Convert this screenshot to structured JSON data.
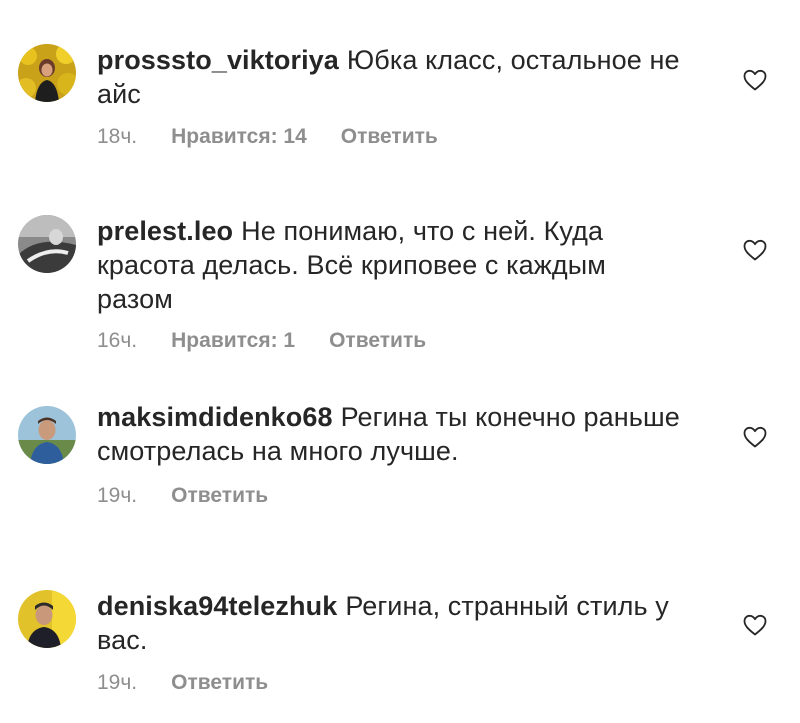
{
  "comments": [
    {
      "username": "prosssto_viktoriya",
      "text": "Юбка класс, остальное не айс",
      "time": "18ч.",
      "likes": "Нравится: 14",
      "reply": "Ответить",
      "avatar_icon": "avatar-photo-yellow-flowers",
      "like_icon": "heart-outline-icon"
    },
    {
      "username": "prelest.leo",
      "text": "Не понимаю, что с ней. Куда красота делась. Всё криповее с каждым разом",
      "time": "16ч.",
      "likes": "Нравится: 1",
      "reply": "Ответить",
      "avatar_icon": "avatar-photo-grayscale",
      "like_icon": "heart-outline-icon"
    },
    {
      "username": "maksimdidenko68",
      "text": "Регина ты конечно раньше смотрелась на много лучше.",
      "time": "19ч.",
      "reply": "Ответить",
      "avatar_icon": "avatar-photo-man-outdoors",
      "like_icon": "heart-outline-icon"
    },
    {
      "username": "deniska94telezhuk",
      "text": "Регина, странный стиль у вас.",
      "time": "19ч.",
      "reply": "Ответить",
      "avatar_icon": "avatar-photo-man-yellow-bg",
      "like_icon": "heart-outline-icon"
    }
  ],
  "colors": {
    "text": "#262626",
    "muted": "#8e8e8e",
    "background": "#ffffff"
  }
}
